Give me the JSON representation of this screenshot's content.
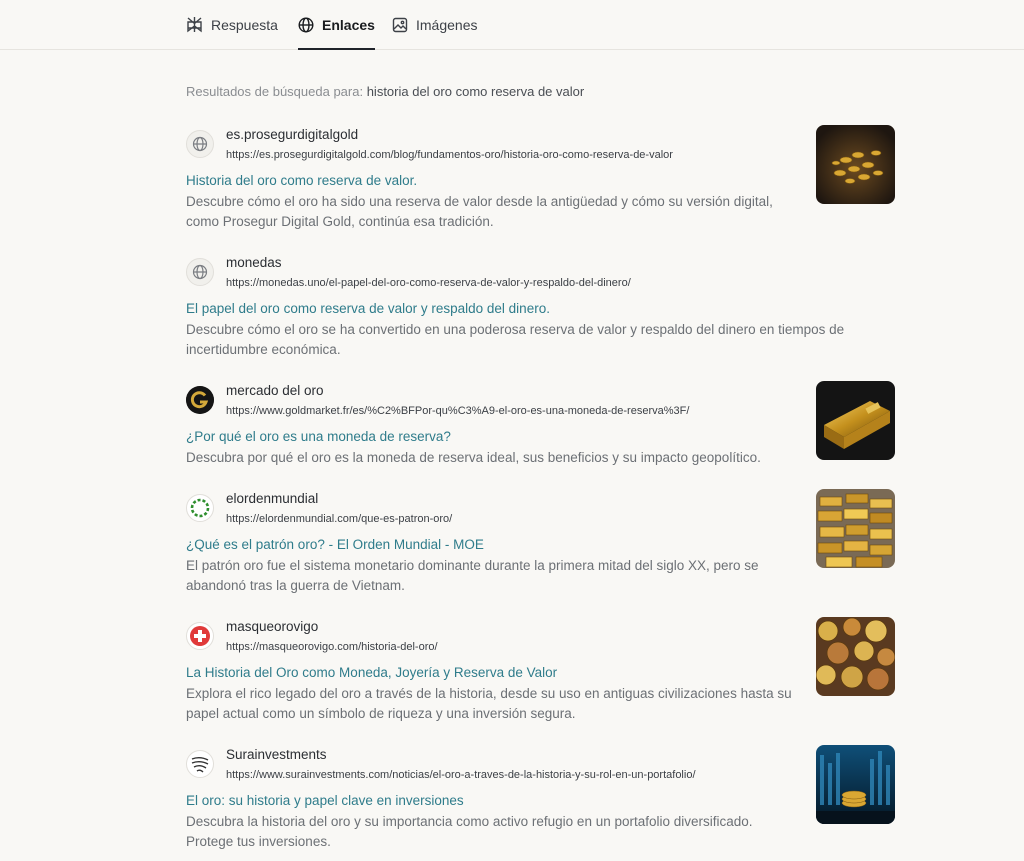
{
  "tabs": [
    {
      "label": "Respuesta",
      "icon": "perplexity-icon",
      "active": false
    },
    {
      "label": "Enlaces",
      "icon": "globe-icon",
      "active": true
    },
    {
      "label": "Imágenes",
      "icon": "image-icon",
      "active": false
    }
  ],
  "search": {
    "prefix": "Resultados de búsqueda para:",
    "query": "historia del oro como reserva de valor"
  },
  "results": [
    {
      "site": "es.prosegurdigitalgold",
      "url": "https://es.prosegurdigitalgold.com/blog/fundamentos-oro/historia-oro-como-reserva-de-valor",
      "title": "Historia del oro como reserva de valor.",
      "description": "Descubre cómo el oro ha sido una reserva de valor desde la antigüedad y cómo su versión digital, como Prosegur Digital Gold, continúa esa tradición.",
      "favicon": "globe-icon",
      "thumbnail": "gold-coins-pile-image"
    },
    {
      "site": "monedas",
      "url": "https://monedas.uno/el-papel-del-oro-como-reserva-de-valor-y-respaldo-del-dinero/",
      "title": "El papel del oro como reserva de valor y respaldo del dinero.",
      "description": "Descubre cómo el oro se ha convertido en una poderosa reserva de valor y respaldo del dinero en tiempos de incertidumbre económica.",
      "favicon": "globe-icon",
      "thumbnail": null
    },
    {
      "site": "mercado del oro",
      "url": "https://www.goldmarket.fr/es/%C2%BFPor-qu%C3%A9-el-oro-es-una-moneda-de-reserva%3F/",
      "title": "¿Por qué el oro es una moneda de reserva?",
      "description": "Descubra por qué el oro es la moneda de reserva ideal, sus beneficios y su impacto geopolítico.",
      "favicon": "goldmarket-logo-icon",
      "thumbnail": "gold-bar-image"
    },
    {
      "site": "elordenmundial",
      "url": "https://elordenmundial.com/que-es-patron-oro/",
      "title": "¿Qué es el patrón oro? - El Orden Mundial - MOE",
      "description": "El patrón oro fue el sistema monetario dominante durante la primera mitad del siglo XX, pero se abandonó tras la guerra de Vietnam.",
      "favicon": "elordenmundial-logo-icon",
      "thumbnail": "stacked-gold-bars-image"
    },
    {
      "site": "masqueorovigo",
      "url": "https://masqueorovigo.com/historia-del-oro/",
      "title": "La Historia del Oro como Moneda, Joyería y Reserva de Valor",
      "description": "Explora el rico legado del oro a través de la historia, desde su uso en antiguas civilizaciones hasta su papel actual como un símbolo de riqueza y una inversión segura.",
      "favicon": "swiss-cross-icon",
      "thumbnail": "mixed-coins-image"
    },
    {
      "site": "Surainvestments",
      "url": "https://www.surainvestments.com/noticias/el-oro-a-traves-de-la-historia-y-su-rol-en-un-portafolio/",
      "title": "El oro: su historia y papel clave en inversiones",
      "description": "Descubra la historia del oro y su importancia como activo refugio en un portafolio diversificado. Protege tus inversiones.",
      "favicon": "sura-logo-icon",
      "thumbnail": "gold-coins-chart-image"
    }
  ],
  "colors": {
    "background": "#f9f8f5",
    "link": "#2f7c8b",
    "description": "#6c7075"
  }
}
